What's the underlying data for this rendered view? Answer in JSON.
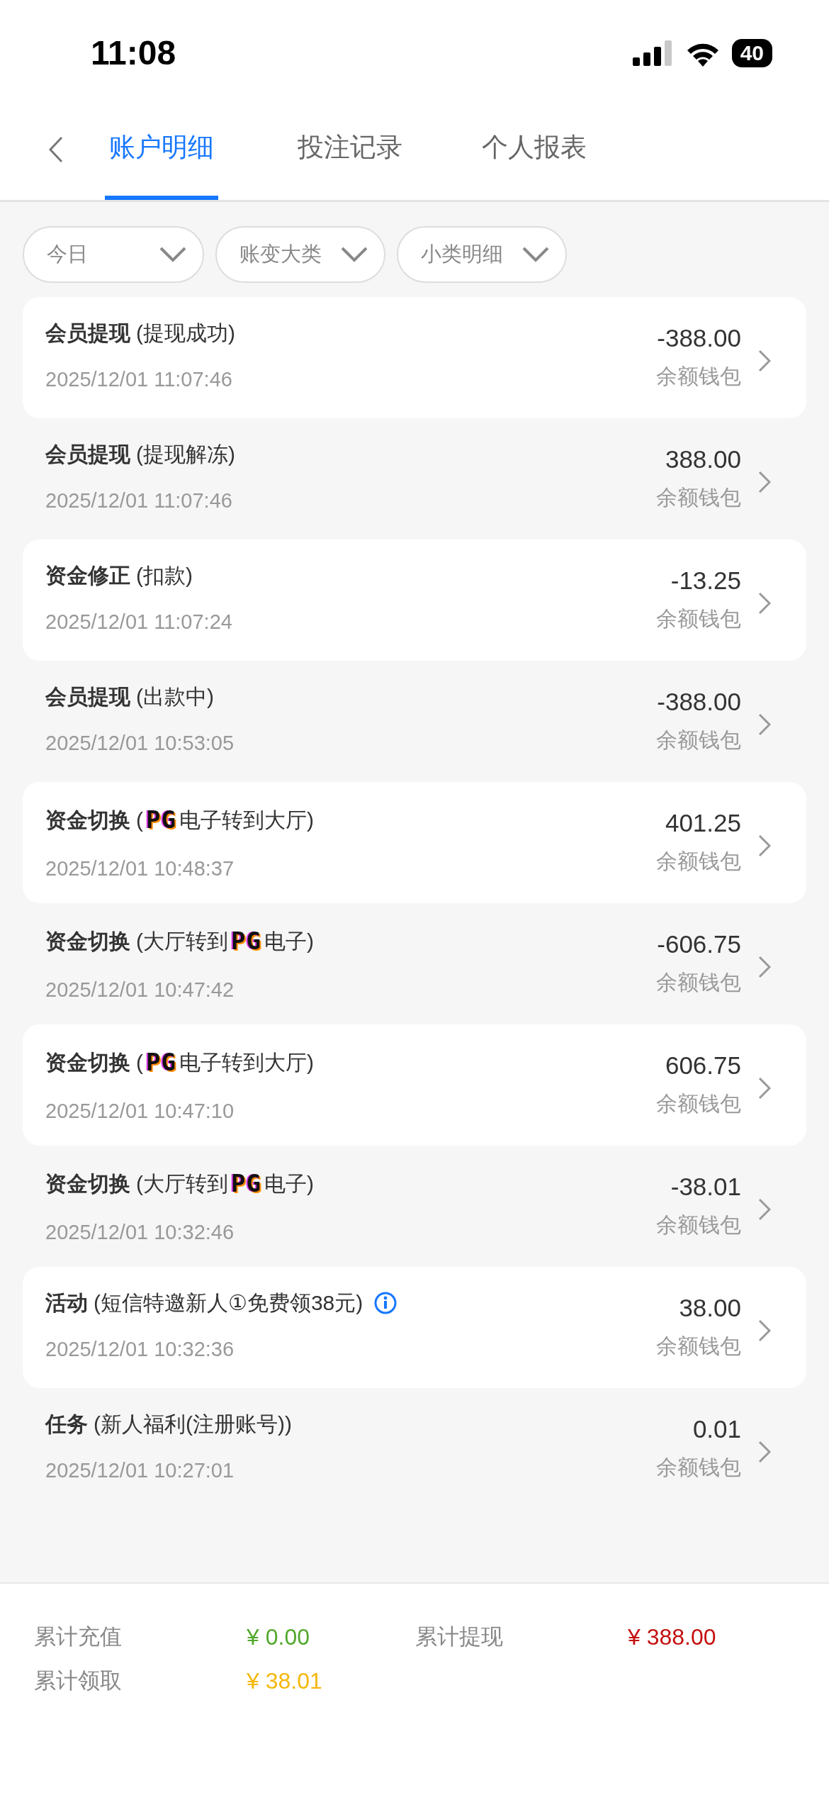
{
  "status_bar": {
    "time": "11:08",
    "battery": "40"
  },
  "tabs": [
    {
      "label": "账户明细",
      "selected": true
    },
    {
      "label": "投注记录",
      "selected": false
    },
    {
      "label": "个人报表",
      "selected": false
    }
  ],
  "filters": [
    {
      "label": "今日"
    },
    {
      "label": "账变大类"
    },
    {
      "label": "小类明细"
    }
  ],
  "records": [
    {
      "category": "会员提现",
      "detail": [
        {
          "kind": "text",
          "text": "(提现成功)"
        }
      ],
      "info": false,
      "time": "2025/12/01 11:07:46",
      "amount": "-388.00",
      "wallet": "余额钱包"
    },
    {
      "category": "会员提现",
      "detail": [
        {
          "kind": "text",
          "text": "(提现解冻)"
        }
      ],
      "info": false,
      "time": "2025/12/01 11:07:46",
      "amount": "388.00",
      "wallet": "余额钱包"
    },
    {
      "category": "资金修正",
      "detail": [
        {
          "kind": "text",
          "text": "(扣款)"
        }
      ],
      "info": false,
      "time": "2025/12/01 11:07:24",
      "amount": "-13.25",
      "wallet": "余额钱包"
    },
    {
      "category": "会员提现",
      "detail": [
        {
          "kind": "text",
          "text": "(出款中)"
        }
      ],
      "info": false,
      "time": "2025/12/01 10:53:05",
      "amount": "-388.00",
      "wallet": "余额钱包"
    },
    {
      "category": "资金切换",
      "detail": [
        {
          "kind": "text",
          "text": "("
        },
        {
          "kind": "logo",
          "text": "PG"
        },
        {
          "kind": "text",
          "text": "电子转到大厅)"
        }
      ],
      "info": false,
      "time": "2025/12/01 10:48:37",
      "amount": "401.25",
      "wallet": "余额钱包"
    },
    {
      "category": "资金切换",
      "detail": [
        {
          "kind": "text",
          "text": "(大厅转到"
        },
        {
          "kind": "logo",
          "text": "PG"
        },
        {
          "kind": "text",
          "text": "电子)"
        }
      ],
      "info": false,
      "time": "2025/12/01 10:47:42",
      "amount": "-606.75",
      "wallet": "余额钱包"
    },
    {
      "category": "资金切换",
      "detail": [
        {
          "kind": "text",
          "text": "("
        },
        {
          "kind": "logo",
          "text": "PG"
        },
        {
          "kind": "text",
          "text": "电子转到大厅)"
        }
      ],
      "info": false,
      "time": "2025/12/01 10:47:10",
      "amount": "606.75",
      "wallet": "余额钱包"
    },
    {
      "category": "资金切换",
      "detail": [
        {
          "kind": "text",
          "text": "(大厅转到"
        },
        {
          "kind": "logo",
          "text": "PG"
        },
        {
          "kind": "text",
          "text": "电子)"
        }
      ],
      "info": false,
      "time": "2025/12/01 10:32:46",
      "amount": "-38.01",
      "wallet": "余额钱包"
    },
    {
      "category": "活动",
      "detail": [
        {
          "kind": "text",
          "text": "(短信特邀新人①免费领38元)"
        }
      ],
      "info": true,
      "time": "2025/12/01 10:32:36",
      "amount": "38.00",
      "wallet": "余额钱包"
    },
    {
      "category": "任务",
      "detail": [
        {
          "kind": "text",
          "text": "(新人福利(注册账号))"
        }
      ],
      "info": false,
      "time": "2025/12/01 10:27:01",
      "amount": "0.01",
      "wallet": "余额钱包"
    }
  ],
  "summary": [
    {
      "label": "累计充值",
      "value": "¥ 0.00",
      "color": "#52a82c"
    },
    {
      "label": "累计提现",
      "value": "¥ 388.00",
      "color": "#c40f0f"
    },
    {
      "label": "累计领取",
      "value": "¥ 38.01",
      "color": "#f5b70a"
    }
  ]
}
